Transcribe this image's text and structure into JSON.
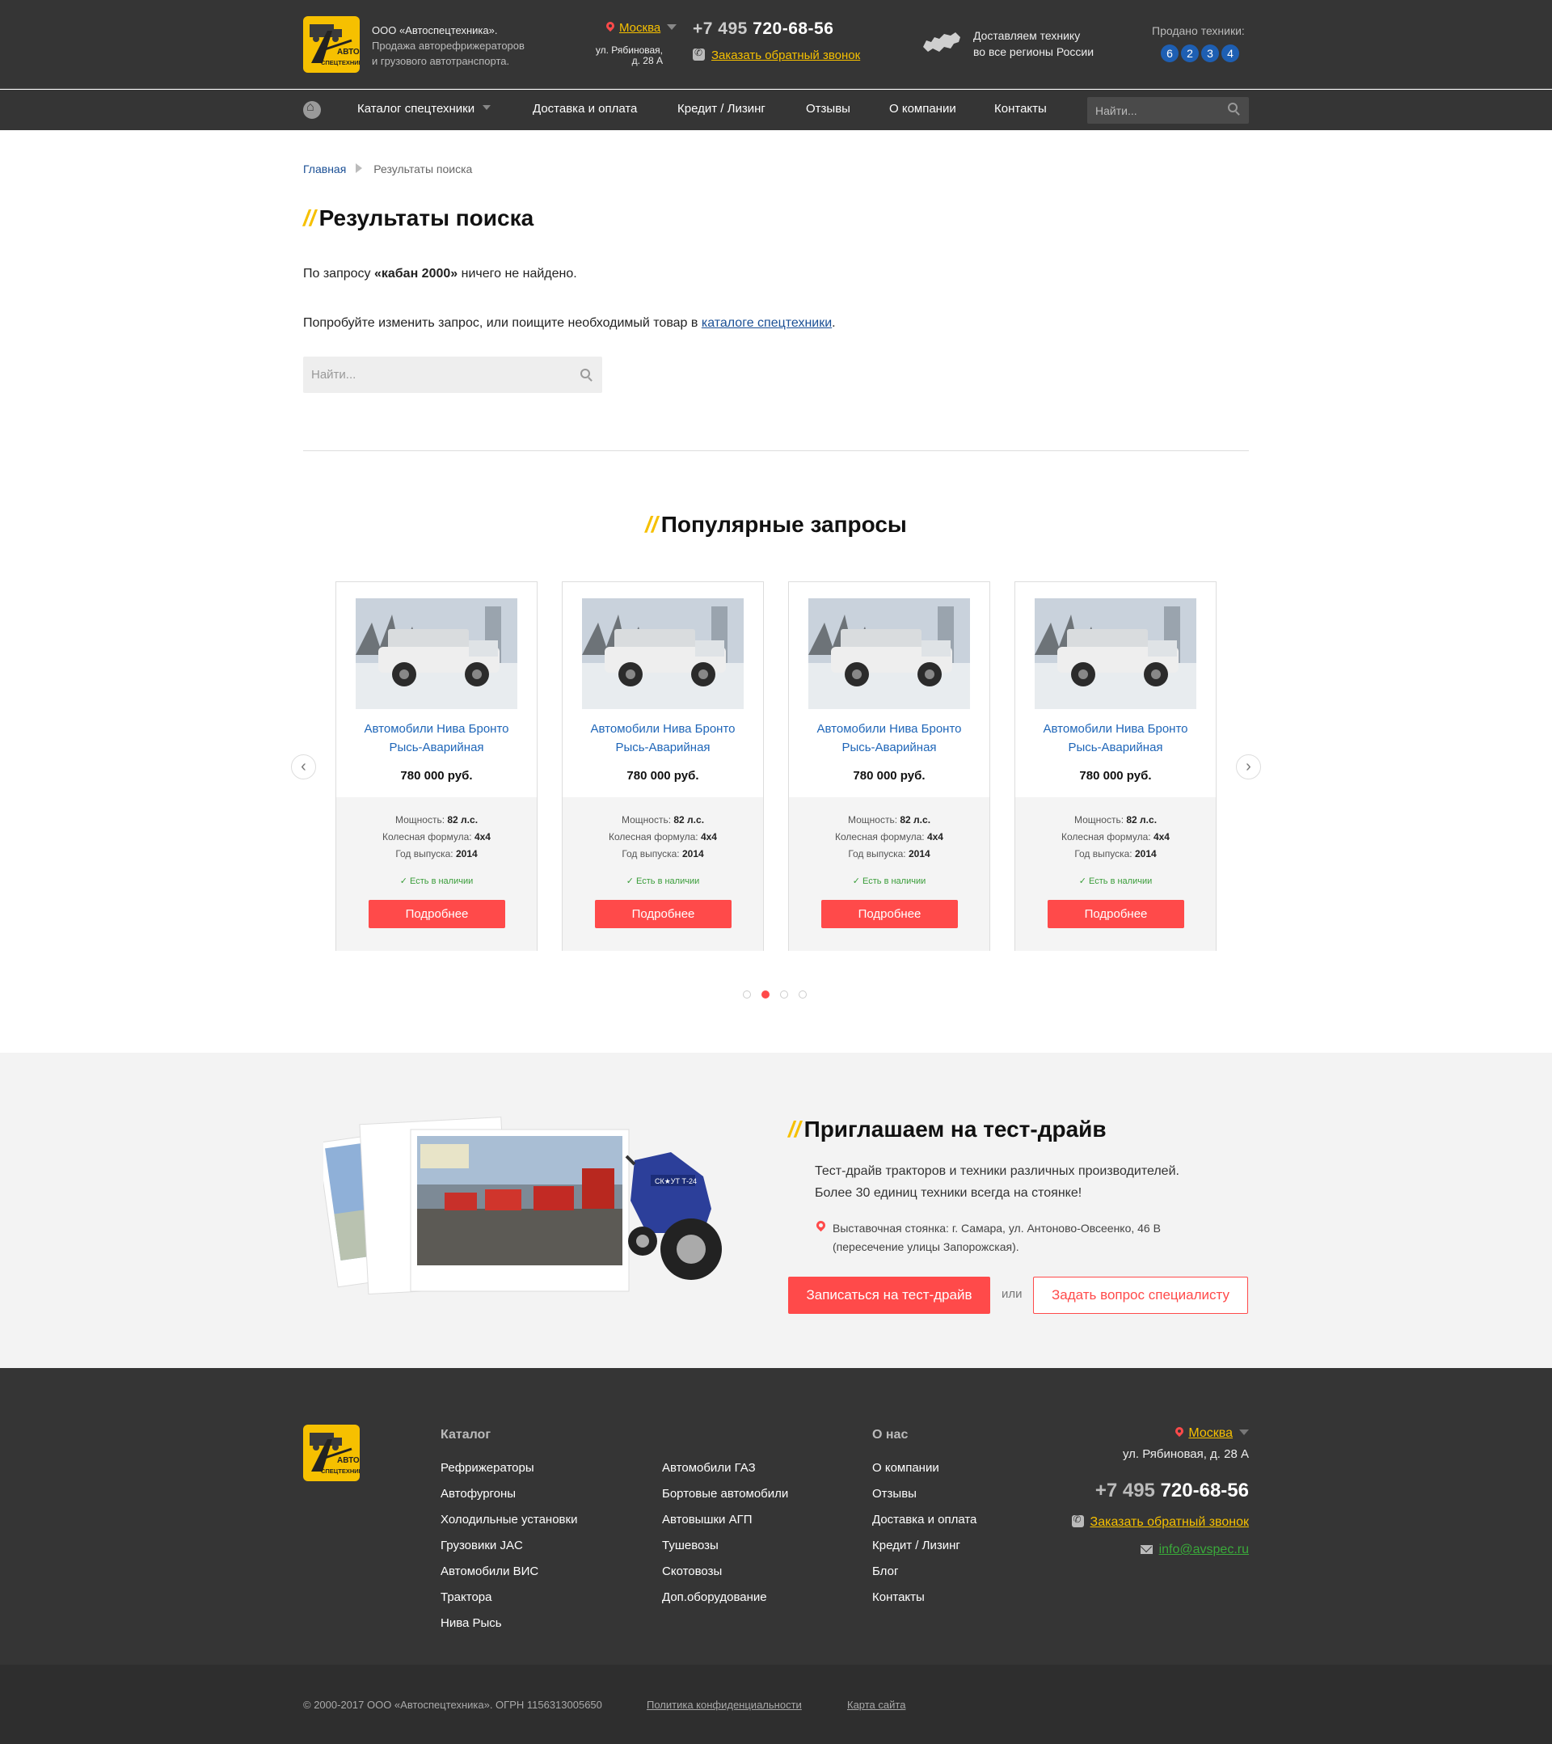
{
  "header": {
    "company_name": "ООО «Автоспецтехника».",
    "company_desc_1": "Продажа авторефрижераторов",
    "company_desc_2": "и грузового автотранспорта.",
    "city": "Москва",
    "address_1": "ул. Рябиновая,",
    "address_2": "д. 28 А",
    "phone_prefix": "+7 495",
    "phone_number": "720-68-56",
    "callback": "Заказать обратный звонок",
    "delivery_1": "Доставляем технику",
    "delivery_2": "во все регионы России",
    "sold_label": "Продано техники:",
    "sold_digits": [
      "6",
      "2",
      "3",
      "4"
    ],
    "logo_text_1": "АВТО",
    "logo_text_2": "СПЕЦТЕХНИКА"
  },
  "nav": {
    "items": [
      "Каталог спецтехники",
      "Доставка и оплата",
      "Кредит / Лизинг",
      "Отзывы",
      "О компании",
      "Контакты"
    ],
    "search_placeholder": "Найти..."
  },
  "breadcrumb": {
    "home": "Главная",
    "current": "Результаты поиска"
  },
  "main": {
    "title": "Результаты поиска",
    "no_result_pre": "По запросу ",
    "query": "«кабан 2000»",
    "no_result_post": " ничего не найдено.",
    "try_pre": "Попробуйте изменить запрос, или поищите необходимый товар в ",
    "try_link": "каталоге спецтехники",
    "try_post": ".",
    "search_placeholder": "Найти..."
  },
  "popular": {
    "title": "Популярные запросы",
    "prev": "‹",
    "next": "›",
    "cards": [
      {
        "name_1": "Автомобили Нива Бронто",
        "name_2": "Рысь-Аварийная",
        "price": "780 000 руб.",
        "power_label": "Мощность:",
        "power": "82 л.с.",
        "wheel_label": "Колесная формула:",
        "wheel": "4x4",
        "year_label": "Год выпуска:",
        "year": "2014",
        "avail": "Есть в наличии",
        "button": "Подробнее"
      },
      {
        "name_1": "Автомобили Нива Бронто",
        "name_2": "Рысь-Аварийная",
        "price": "780 000 руб.",
        "power_label": "Мощность:",
        "power": "82 л.с.",
        "wheel_label": "Колесная формула:",
        "wheel": "4x4",
        "year_label": "Год выпуска:",
        "year": "2014",
        "avail": "Есть в наличии",
        "button": "Подробнее"
      },
      {
        "name_1": "Автомобили Нива Бронто",
        "name_2": "Рысь-Аварийная",
        "price": "780 000 руб.",
        "power_label": "Мощность:",
        "power": "82 л.с.",
        "wheel_label": "Колесная формула:",
        "wheel": "4x4",
        "year_label": "Год выпуска:",
        "year": "2014",
        "avail": "Есть в наличии",
        "button": "Подробнее"
      },
      {
        "name_1": "Автомобили Нива Бронто",
        "name_2": "Рысь-Аварийная",
        "price": "780 000 руб.",
        "power_label": "Мощность:",
        "power": "82 л.с.",
        "wheel_label": "Колесная формула:",
        "wheel": "4x4",
        "year_label": "Год выпуска:",
        "year": "2014",
        "avail": "Есть в наличии",
        "button": "Подробнее"
      }
    ],
    "active_dot": 2,
    "dots_total": 4
  },
  "testdrive": {
    "title": "Приглашаем на тест-драйв",
    "text_1": "Тест-драйв тракторов и техники различных производителей.",
    "text_2": "Более 30 единиц техники всегда на стоянке!",
    "addr_1": "Выставочная стоянка: г. Самара, ул. Антоново-Овсеенко, 46 В",
    "addr_2": "(пересечение улицы Запорожская).",
    "btn_primary": "Записаться на тест-драйв",
    "or": "или",
    "btn_secondary": "Задать вопрос специалисту",
    "tractor_label": "СК★УТ Т-24"
  },
  "footer": {
    "catalog_title": "Каталог",
    "catalog_col1": [
      "Рефрижераторы",
      "Автофургоны",
      "Холодильные установки",
      "Грузовики JAC",
      "Автомобили ВИС",
      "Трактора",
      "Нива Рысь"
    ],
    "catalog_col2": [
      "Автомобили ГАЗ",
      "Бортовые автомобили",
      "Автовышки АГП",
      "Тушевозы",
      "Скотовозы",
      "Доп.оборудование"
    ],
    "about_title": "О нас",
    "about_items": [
      "О компании",
      "Отзывы",
      "Доставка и оплата",
      "Кредит / Лизинг",
      "Блог",
      "Контакты"
    ],
    "city": "Москва",
    "address": "ул. Рябиновая, д. 28 А",
    "phone_prefix": "+7 495",
    "phone_number": "720-68-56",
    "callback": "Заказать обратный звонок",
    "email": "info@avspec.ru",
    "copyright": "© 2000-2017 ООО «Автоспецтехника». ОГРН 1156313005650",
    "policy": "Политика конфиденциальности",
    "sitemap": "Карта сайта"
  },
  "colors": {
    "accent": "#f6c000",
    "button": "#ff4a4a",
    "dark": "#353535",
    "link": "#1f66b8"
  }
}
